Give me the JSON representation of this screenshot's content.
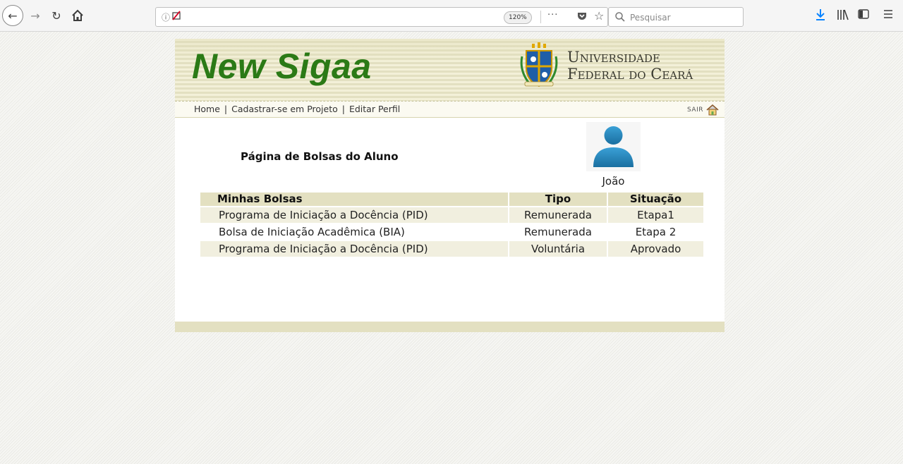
{
  "browser": {
    "zoom_level": "120%",
    "search_placeholder": "Pesquisar",
    "more_label": "···"
  },
  "site": {
    "logo_text": "New Sigaa",
    "university_line1": "Universidade",
    "university_line2": "Federal do Ceará",
    "nav": [
      {
        "label": "Home"
      },
      {
        "label": "Cadastrar-se em Projeto"
      },
      {
        "label": "Editar Perfil"
      }
    ],
    "logout_label": "SAIR",
    "colors": {
      "brand_green": "#2b7a16",
      "header_beige": "#e3e0c1",
      "row_alt": "#f1efdf"
    }
  },
  "main": {
    "page_title": "Página de Bolsas do Aluno",
    "user_name": "João",
    "table": {
      "headers": [
        "Minhas Bolsas",
        "Tipo",
        "Situação"
      ],
      "rows": [
        [
          "Programa de Iniciação a Docência (PID)",
          "Remunerada",
          "Etapa1"
        ],
        [
          "Bolsa de Iniciação Acadêmica (BIA)",
          "Remunerada",
          "Etapa 2"
        ],
        [
          "Programa de Iniciação a Docência (PID)",
          "Voluntária",
          "Aprovado"
        ]
      ]
    }
  }
}
